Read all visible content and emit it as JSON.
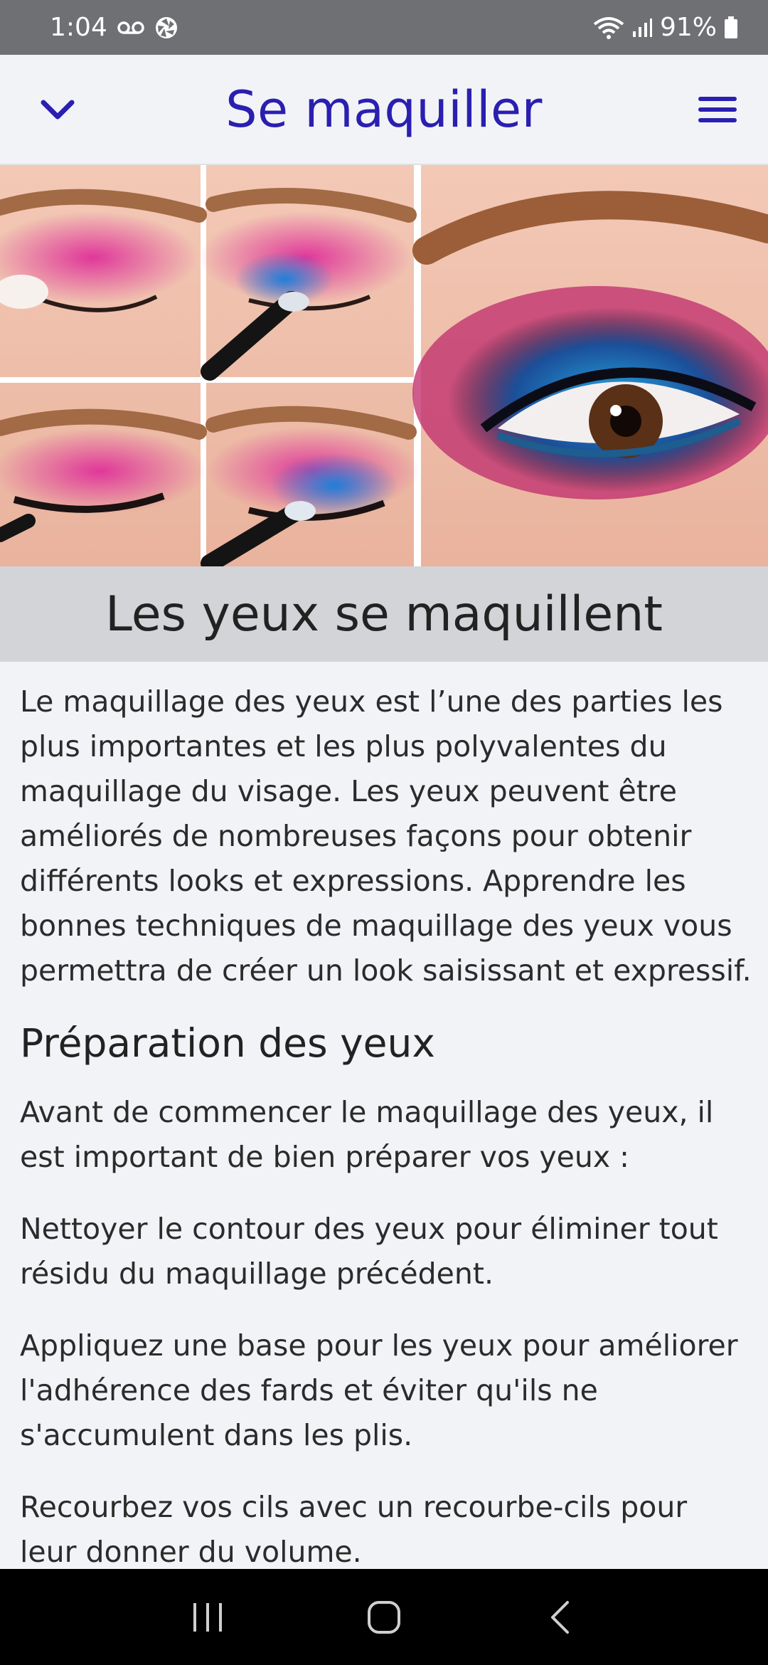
{
  "status_bar": {
    "time": "1:04",
    "battery": "91%",
    "icons": [
      "voicemail-icon",
      "aperture-icon",
      "wifi-icon",
      "signal-icon",
      "battery-icon"
    ]
  },
  "app_bar": {
    "title": "Se maquiller",
    "left_icon": "chevron-down-icon",
    "right_icon": "hamburger-menu-icon"
  },
  "hero": {
    "description_icon": "eye-makeup-tutorial-image"
  },
  "section": {
    "title": "Les yeux se maquillent"
  },
  "content": {
    "intro": "Le maquillage des yeux est l’une des parties les plus importantes et les plus polyvalentes du maquillage du visage. Les yeux peuvent être améliorés de nombreuses façons pour obtenir différents looks et expressions. Apprendre les bonnes techniques de maquillage des yeux vous permettra de créer un look saisissant et expressif.",
    "heading": "Préparation des yeux",
    "p1": "Avant de commencer le maquillage des yeux, il est important de bien préparer vos yeux :",
    "p2": "Nettoyer le contour des yeux pour éliminer tout résidu du maquillage précédent.",
    "p3": "Appliquez une base pour les yeux pour améliorer l'adhérence des fards et éviter qu'ils ne s'accumulent dans les plis.",
    "p4": "Recourbez vos cils avec un recourbe-cils pour leur donner du volume."
  },
  "nav_bar": {
    "icons": [
      "recent-apps-icon",
      "home-icon",
      "back-icon"
    ]
  },
  "colors": {
    "accent": "#2a1fb0",
    "status_bar": "#6f7073",
    "section_band": "#d3d4d7",
    "background": "#f2f3f6"
  }
}
